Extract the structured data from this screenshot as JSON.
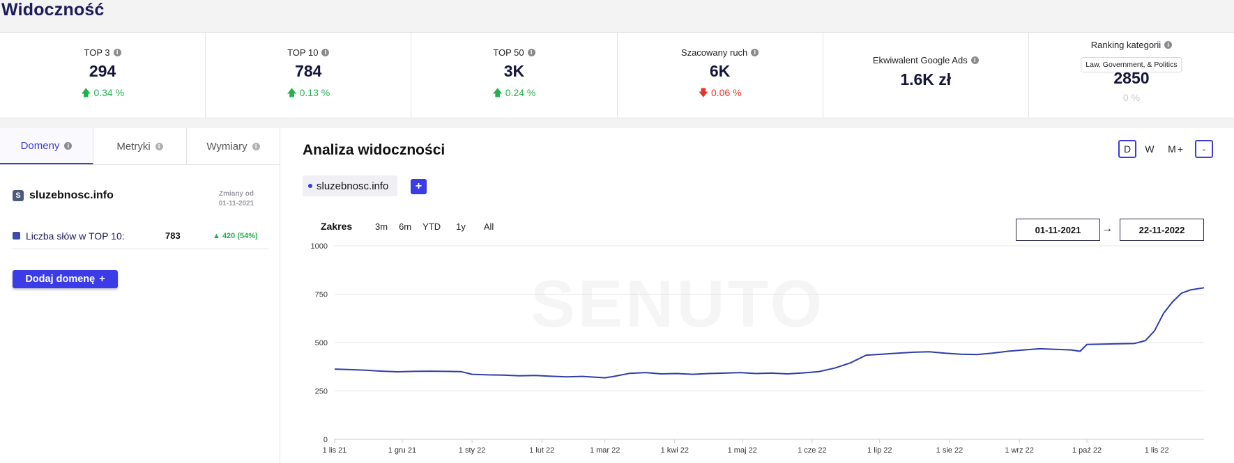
{
  "page": {
    "title": "Widoczność"
  },
  "stats": [
    {
      "label": "TOP 3",
      "value": "294",
      "change": "0.34 %",
      "direction": "up"
    },
    {
      "label": "TOP 10",
      "value": "784",
      "change": "0.13 %",
      "direction": "up"
    },
    {
      "label": "TOP 50",
      "value": "3K",
      "change": "0.24 %",
      "direction": "up"
    },
    {
      "label": "Szacowany ruch",
      "value": "6K",
      "change": "0.06 %",
      "direction": "down"
    },
    {
      "label": "Ekwiwalent Google Ads",
      "value": "1.6K zł"
    },
    {
      "label": "Ranking kategorii",
      "badge": "Law, Government, & Politics",
      "value": "2850",
      "change": "0 %",
      "direction": "neutral"
    }
  ],
  "left_panel": {
    "tabs": [
      "Domeny",
      "Metryki",
      "Wymiary"
    ],
    "active_tab": "Domeny",
    "domain": {
      "icon_letter": "S",
      "name": "sluzebnosc.info",
      "changes_label": "Zmiany od",
      "changes_date": "01-11-2021"
    },
    "metric": {
      "label": "Liczba słów w TOP 10:",
      "value": "783",
      "change": "▲ 420 (54%)",
      "color": "#3c4aa8"
    },
    "add_domain_label": "Dodaj domenę",
    "add_domain_icon": "+"
  },
  "analysis": {
    "title": "Analiza widoczności",
    "periods": [
      "D",
      "W",
      "M"
    ],
    "active_period": "D",
    "zoom": [
      "+",
      "-"
    ],
    "active_zoom": "-",
    "series_chip": "sluzebnosc.info",
    "add_series_icon": "+",
    "range_label": "Zakres",
    "range_options": [
      "3m",
      "6m",
      "YTD",
      "1y",
      "All"
    ],
    "date_from": "01-11-2021",
    "date_arrow": "→",
    "date_to": "22-11-2022",
    "watermark": "SENUTO"
  },
  "chart_data": {
    "type": "line",
    "ylim": [
      0,
      1000
    ],
    "y_ticks": [
      0,
      250,
      500,
      750,
      1000
    ],
    "x_tick_labels": [
      "1 lis 21",
      "1 gru 21",
      "1 sty 22",
      "1 lut 22",
      "1 mar 22",
      "1 kwi 22",
      "1 maj 22",
      "1 cze 22",
      "1 lip 22",
      "1 sie 22",
      "1 wrz 22",
      "1 paź 22",
      "1 lis 22"
    ],
    "x_start": "2021-11-01",
    "x_end": "2022-11-22",
    "color": "#2e3da8",
    "series": [
      {
        "points": [
          [
            "2021-11-01",
            363
          ],
          [
            "2021-11-08",
            360
          ],
          [
            "2021-11-15",
            357
          ],
          [
            "2021-11-22",
            352
          ],
          [
            "2021-11-29",
            349
          ],
          [
            "2021-12-06",
            351
          ],
          [
            "2021-12-13",
            352
          ],
          [
            "2021-12-20",
            351
          ],
          [
            "2021-12-27",
            350
          ],
          [
            "2022-01-01",
            336
          ],
          [
            "2022-01-08",
            333
          ],
          [
            "2022-01-15",
            332
          ],
          [
            "2022-01-22",
            328
          ],
          [
            "2022-01-29",
            330
          ],
          [
            "2022-02-05",
            326
          ],
          [
            "2022-02-12",
            323
          ],
          [
            "2022-02-19",
            325
          ],
          [
            "2022-02-26",
            320
          ],
          [
            "2022-03-01",
            318
          ],
          [
            "2022-03-05",
            325
          ],
          [
            "2022-03-12",
            341
          ],
          [
            "2022-03-19",
            345
          ],
          [
            "2022-03-26",
            338
          ],
          [
            "2022-04-02",
            340
          ],
          [
            "2022-04-09",
            336
          ],
          [
            "2022-04-16",
            340
          ],
          [
            "2022-04-23",
            342
          ],
          [
            "2022-04-30",
            345
          ],
          [
            "2022-05-07",
            340
          ],
          [
            "2022-05-14",
            342
          ],
          [
            "2022-05-21",
            338
          ],
          [
            "2022-05-28",
            343
          ],
          [
            "2022-06-04",
            350
          ],
          [
            "2022-06-11",
            368
          ],
          [
            "2022-06-18",
            395
          ],
          [
            "2022-06-25",
            435
          ],
          [
            "2022-07-02",
            440
          ],
          [
            "2022-07-09",
            445
          ],
          [
            "2022-07-16",
            450
          ],
          [
            "2022-07-23",
            452
          ],
          [
            "2022-07-30",
            445
          ],
          [
            "2022-08-06",
            440
          ],
          [
            "2022-08-13",
            438
          ],
          [
            "2022-08-20",
            445
          ],
          [
            "2022-08-27",
            455
          ],
          [
            "2022-09-03",
            462
          ],
          [
            "2022-09-10",
            468
          ],
          [
            "2022-09-17",
            465
          ],
          [
            "2022-09-24",
            462
          ],
          [
            "2022-09-28",
            455
          ],
          [
            "2022-10-01",
            490
          ],
          [
            "2022-10-08",
            492
          ],
          [
            "2022-10-15",
            494
          ],
          [
            "2022-10-22",
            495
          ],
          [
            "2022-10-27",
            510
          ],
          [
            "2022-10-31",
            560
          ],
          [
            "2022-11-04",
            650
          ],
          [
            "2022-11-08",
            710
          ],
          [
            "2022-11-12",
            755
          ],
          [
            "2022-11-16",
            772
          ],
          [
            "2022-11-22",
            783
          ]
        ]
      }
    ]
  }
}
